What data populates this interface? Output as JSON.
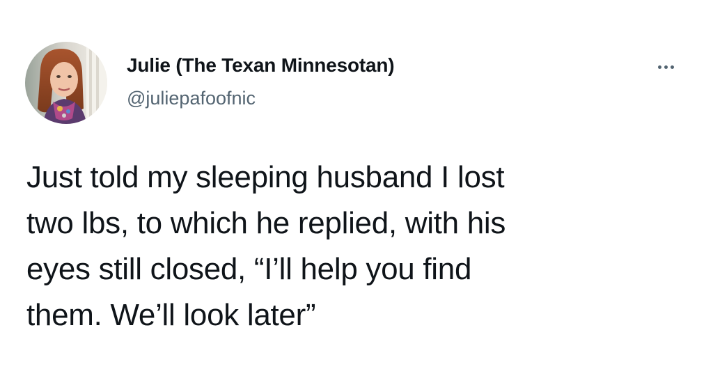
{
  "author": {
    "name": "Julie (The Texan Minnesotan)",
    "handle": "@juliepafoofnic",
    "avatar_icon": "profile-photo"
  },
  "menu": {
    "icon": "more-horizontal-icon"
  },
  "tweet": {
    "lines": [
      "Just told my sleeping husband I lost",
      "two lbs, to which he replied, with his",
      "eyes still closed, “I’ll help you find",
      "them. We’ll look later”"
    ]
  },
  "colors": {
    "text": "#0f1419",
    "secondary_text": "#536471",
    "background": "#ffffff"
  }
}
